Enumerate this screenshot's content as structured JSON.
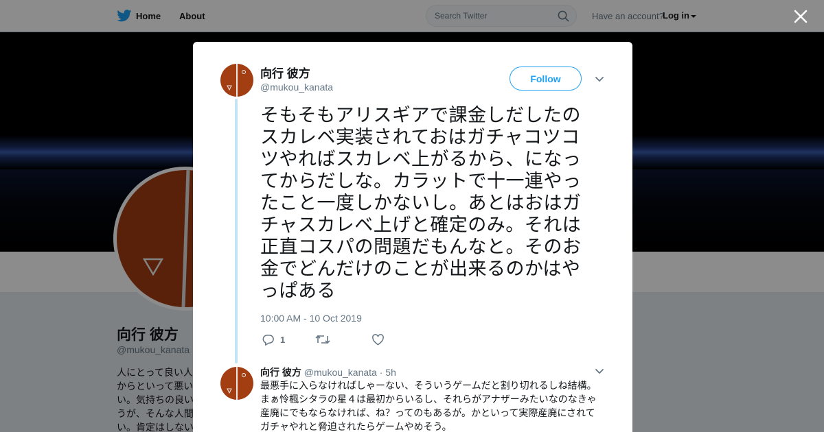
{
  "colors": {
    "brand": "#1da1f2",
    "avatar_bg": "#a33d12",
    "thread_line": "#c4e3f5",
    "muted": "#657786"
  },
  "topbar": {
    "home_label": "Home",
    "about_label": "About",
    "search_placeholder": "Search Twitter",
    "account_text": "Have an account?",
    "login_label": "Log in",
    "icons": {
      "logo": "twitter-bird-icon",
      "search": "search-icon",
      "caret": "caret-down-icon"
    }
  },
  "profile": {
    "name": "向行 彼方",
    "handle": "@mukou_kanata",
    "bio": "人にとって良い人\nからといって悪い\nい。気持ちの良い\nうが、そんな人間\nい。肯定はしない"
  },
  "modal": {
    "author_name": "向行 彼方",
    "author_handle": "@mukou_kanata",
    "follow_label": "Follow",
    "tweet_text": "そもそもアリスギアで課金しだしたのスカレベ実装されておはガチャコツコツやればスカレベ上がるから、になってからだしな。カラットで十一連やったこと一度しかないし。あとはおはガチャスカレベ上げと確定のみ。それは正直コスパの問題だもんなと。そのお金でどんだけのことが出来るのかはやっぱある",
    "timestamp": "10:00 AM - 10 Oct 2019",
    "actions": {
      "reply_count": "1",
      "retweet_count": "",
      "like_count": ""
    },
    "reply": {
      "author_name": "向行 彼方",
      "author_handle": "@mukou_kanata",
      "time": "· 5h",
      "text": "最悪手に入らなければしゃーない、そういうゲームだと割り切れるしね結構。\nまぁ怜楓シタラの星４は最初からいるし、それらがアナザーみたいなのなきゃ\n産廃にでもならなければ、ね？ってのもあるが。かといって実際産廃にされて\nガチャやれと脅迫されたらゲームやめそう。"
    }
  }
}
